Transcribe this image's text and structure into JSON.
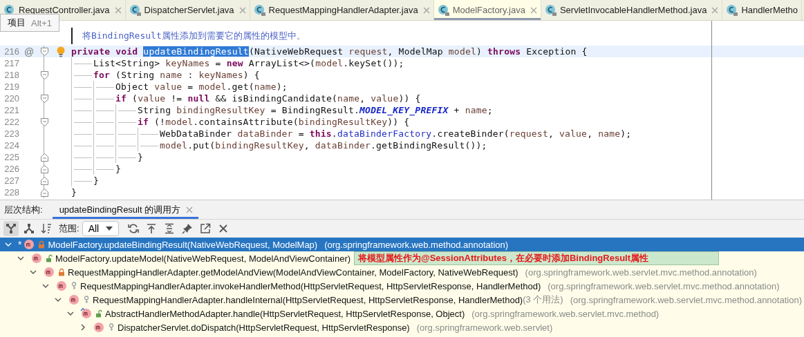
{
  "tabs": [
    {
      "label": "RequestController.java",
      "locked": false,
      "selected": false,
      "closable": true
    },
    {
      "label": "DispatcherServlet.java",
      "locked": true,
      "selected": false,
      "closable": true
    },
    {
      "label": "RequestMappingHandlerAdapter.java",
      "locked": true,
      "selected": false,
      "closable": true
    },
    {
      "label": "ModelFactory.java",
      "locked": true,
      "selected": true,
      "closable": true
    },
    {
      "label": "ServletInvocableHandlerMethod.java",
      "locked": true,
      "selected": false,
      "closable": true
    },
    {
      "label": "HandlerMetho",
      "locked": true,
      "selected": false,
      "closable": false
    }
  ],
  "project_tooltip": {
    "label": "项目",
    "shortcut": "Alt+1"
  },
  "doc_comment": "将BindingResult属性添加到需要它的属性的模型中。",
  "code_lines": [
    {
      "number": "216",
      "gutter_mark": "@",
      "bulb": true,
      "current": true,
      "kind": "block_start",
      "tokens": [
        {
          "kind": "kw",
          "text": "private void "
        },
        {
          "kind": "sel",
          "text": "updateBindingResult"
        },
        {
          "kind": "text",
          "text": "(NativeWebRequest "
        },
        {
          "kind": "var",
          "text": "request"
        },
        {
          "kind": "text",
          "text": ", ModelMap "
        },
        {
          "kind": "var",
          "text": "model"
        },
        {
          "kind": "text",
          "text": ") "
        },
        {
          "kind": "kw",
          "text": "throws"
        },
        {
          "kind": "text",
          "text": " Exception {"
        }
      ],
      "children": [
        {
          "number": "217",
          "current": false,
          "tokens": [
            {
              "kind": "text",
              "text": "List<String> "
            },
            {
              "kind": "var",
              "text": "keyNames"
            },
            {
              "kind": "text",
              "text": " = "
            },
            {
              "kind": "kw",
              "text": "new"
            },
            {
              "kind": "text",
              "text": " ArrayList<>("
            },
            {
              "kind": "var",
              "text": "model"
            },
            {
              "kind": "text",
              "text": ".keySet());"
            }
          ]
        },
        {
          "number": "218",
          "current": false,
          "kind": "block_start",
          "tokens": [
            {
              "kind": "kw",
              "text": "for"
            },
            {
              "kind": "text",
              "text": " (String "
            },
            {
              "kind": "var",
              "text": "name"
            },
            {
              "kind": "text",
              "text": " : "
            },
            {
              "kind": "var",
              "text": "keyNames"
            },
            {
              "kind": "text",
              "text": ") {"
            }
          ],
          "children": [
            {
              "number": "219",
              "current": false,
              "tokens": [
                {
                  "kind": "text",
                  "text": "Object "
                },
                {
                  "kind": "var",
                  "text": "value"
                },
                {
                  "kind": "text",
                  "text": " = "
                },
                {
                  "kind": "var",
                  "text": "model"
                },
                {
                  "kind": "text",
                  "text": ".get("
                },
                {
                  "kind": "var",
                  "text": "name"
                },
                {
                  "kind": "text",
                  "text": ");"
                }
              ]
            },
            {
              "number": "220",
              "current": false,
              "kind": "block_start",
              "tokens": [
                {
                  "kind": "kw",
                  "text": "if"
                },
                {
                  "kind": "text",
                  "text": " ("
                },
                {
                  "kind": "var",
                  "text": "value"
                },
                {
                  "kind": "text",
                  "text": " != "
                },
                {
                  "kind": "kw",
                  "text": "null"
                },
                {
                  "kind": "text",
                  "text": " && isBindingCandidate("
                },
                {
                  "kind": "var",
                  "text": "name"
                },
                {
                  "kind": "text",
                  "text": ", "
                },
                {
                  "kind": "var",
                  "text": "value"
                },
                {
                  "kind": "text",
                  "text": ")) {"
                }
              ],
              "children": [
                {
                  "number": "221",
                  "current": false,
                  "tokens": [
                    {
                      "kind": "text",
                      "text": "String "
                    },
                    {
                      "kind": "var",
                      "text": "bindingResultKey"
                    },
                    {
                      "kind": "text",
                      "text": " = BindingResult."
                    },
                    {
                      "kind": "const",
                      "text": "MODEL_KEY_PREFIX"
                    },
                    {
                      "kind": "text",
                      "text": " + "
                    },
                    {
                      "kind": "var",
                      "text": "name"
                    },
                    {
                      "kind": "text",
                      "text": ";"
                    }
                  ]
                },
                {
                  "number": "222",
                  "current": false,
                  "kind": "block_start",
                  "tokens": [
                    {
                      "kind": "kw",
                      "text": "if"
                    },
                    {
                      "kind": "text",
                      "text": " (!"
                    },
                    {
                      "kind": "var",
                      "text": "model"
                    },
                    {
                      "kind": "text",
                      "text": ".containsAttribute("
                    },
                    {
                      "kind": "var",
                      "text": "bindingResultKey"
                    },
                    {
                      "kind": "text",
                      "text": ")) {"
                    }
                  ],
                  "children": [
                    {
                      "number": "223",
                      "current": false,
                      "tokens": [
                        {
                          "kind": "text",
                          "text": "WebDataBinder "
                        },
                        {
                          "kind": "var",
                          "text": "dataBinder"
                        },
                        {
                          "kind": "text",
                          "text": " = "
                        },
                        {
                          "kind": "kw",
                          "text": "this"
                        },
                        {
                          "kind": "text",
                          "text": "."
                        },
                        {
                          "kind": "field",
                          "text": "dataBinderFactory"
                        },
                        {
                          "kind": "text",
                          "text": ".createBinder("
                        },
                        {
                          "kind": "var",
                          "text": "request"
                        },
                        {
                          "kind": "text",
                          "text": ", "
                        },
                        {
                          "kind": "var",
                          "text": "value"
                        },
                        {
                          "kind": "text",
                          "text": ", "
                        },
                        {
                          "kind": "var",
                          "text": "name"
                        },
                        {
                          "kind": "text",
                          "text": ");"
                        }
                      ]
                    },
                    {
                      "number": "224",
                      "current": false,
                      "tokens": [
                        {
                          "kind": "var",
                          "text": "model"
                        },
                        {
                          "kind": "text",
                          "text": ".put("
                        },
                        {
                          "kind": "var",
                          "text": "bindingResultKey"
                        },
                        {
                          "kind": "text",
                          "text": ", "
                        },
                        {
                          "kind": "var",
                          "text": "dataBinder"
                        },
                        {
                          "kind": "text",
                          "text": ".getBindingResult());"
                        }
                      ]
                    }
                  ]
                },
                {
                  "number": "225",
                  "current": false,
                  "kind": "block_end",
                  "tokens": [
                    {
                      "kind": "text",
                      "text": "}"
                    }
                  ]
                }
              ]
            },
            {
              "number": "226",
              "current": false,
              "kind": "block_end",
              "tokens": [
                {
                  "kind": "text",
                  "text": "}"
                }
              ]
            }
          ]
        },
        {
          "number": "227",
          "current": false,
          "kind": "block_end",
          "tokens": [
            {
              "kind": "text",
              "text": "}"
            }
          ]
        }
      ]
    },
    {
      "number": "228",
      "current": false,
      "kind": "block_end",
      "tokens": [
        {
          "kind": "text",
          "text": "}"
        }
      ]
    }
  ],
  "hierarchy": {
    "label": "层次结构:",
    "tab": {
      "label": "updateBindingResult 的调用方",
      "selected": true
    },
    "toolbar": [
      {
        "kind": "callers",
        "selected": true
      },
      {
        "kind": "callees",
        "selected": false
      },
      {
        "kind": "sort",
        "selected": false
      }
    ],
    "scope": {
      "label": "范围:",
      "value": "All"
    },
    "actions": [
      {
        "kind": "refresh"
      },
      {
        "kind": "export"
      },
      {
        "kind": "expand"
      },
      {
        "kind": "pin"
      },
      {
        "kind": "open"
      },
      {
        "kind": "close"
      }
    ],
    "tree": [
      {
        "marker": "*",
        "kind": "private",
        "override": false,
        "method": "ModelFactory.updateBindingResult(NativeWebRequest, ModelMap)",
        "package": "(org.springframework.web.method.annotation)",
        "selected": true,
        "expanded": true,
        "children": [
          {
            "kind": "public",
            "override": false,
            "method": "ModelFactory.updateModel(NativeWebRequest, ModelAndViewContainer)",
            "selected": false,
            "expanded": true,
            "children": [
              {
                "kind": "private",
                "override": false,
                "method": "RequestMappingHandlerAdapter.getModelAndView(ModelAndViewContainer, ModelFactory, NativeWebRequest)",
                "package": "(org.springframework.web.servlet.mvc.method.annotation)",
                "selected": false,
                "expanded": true,
                "children": [
                  {
                    "kind": "protected",
                    "override": false,
                    "method": "RequestMappingHandlerAdapter.invokeHandlerMethod(HttpServletRequest, HttpServletResponse, HandlerMethod)",
                    "package": "(org.springframework.web.servlet.mvc.method.annotation)",
                    "selected": false,
                    "expanded": true,
                    "children": [
                      {
                        "kind": "protected",
                        "override": false,
                        "method": "RequestMappingHandlerAdapter.handleInternal(HttpServletRequest, HttpServletResponse, HandlerMethod)",
                        "usages": "(3 个用法)",
                        "package": "(org.springframework.web.servlet.mvc.method.annotation)",
                        "selected": false,
                        "expanded": true,
                        "children": [
                          {
                            "kind": "public",
                            "override": true,
                            "method": "AbstractHandlerMethodAdapter.handle(HttpServletRequest, HttpServletResponse, Object)",
                            "package": "(org.springframework.web.servlet.mvc.method)",
                            "selected": false,
                            "expanded": true,
                            "children": [
                              {
                                "kind": "protected",
                                "override": false,
                                "method": "DispatcherServlet.doDispatch(HttpServletRequest, HttpServletResponse)",
                                "package": "(org.springframework.web.servlet)",
                                "selected": false,
                                "expanded": false
                              }
                            ]
                          }
                        ]
                      }
                    ]
                  }
                ]
              }
            ]
          }
        ]
      }
    ],
    "tooltip": "将模型属性作为@SessionAttributes，在必要时添加BindingResult属性"
  }
}
